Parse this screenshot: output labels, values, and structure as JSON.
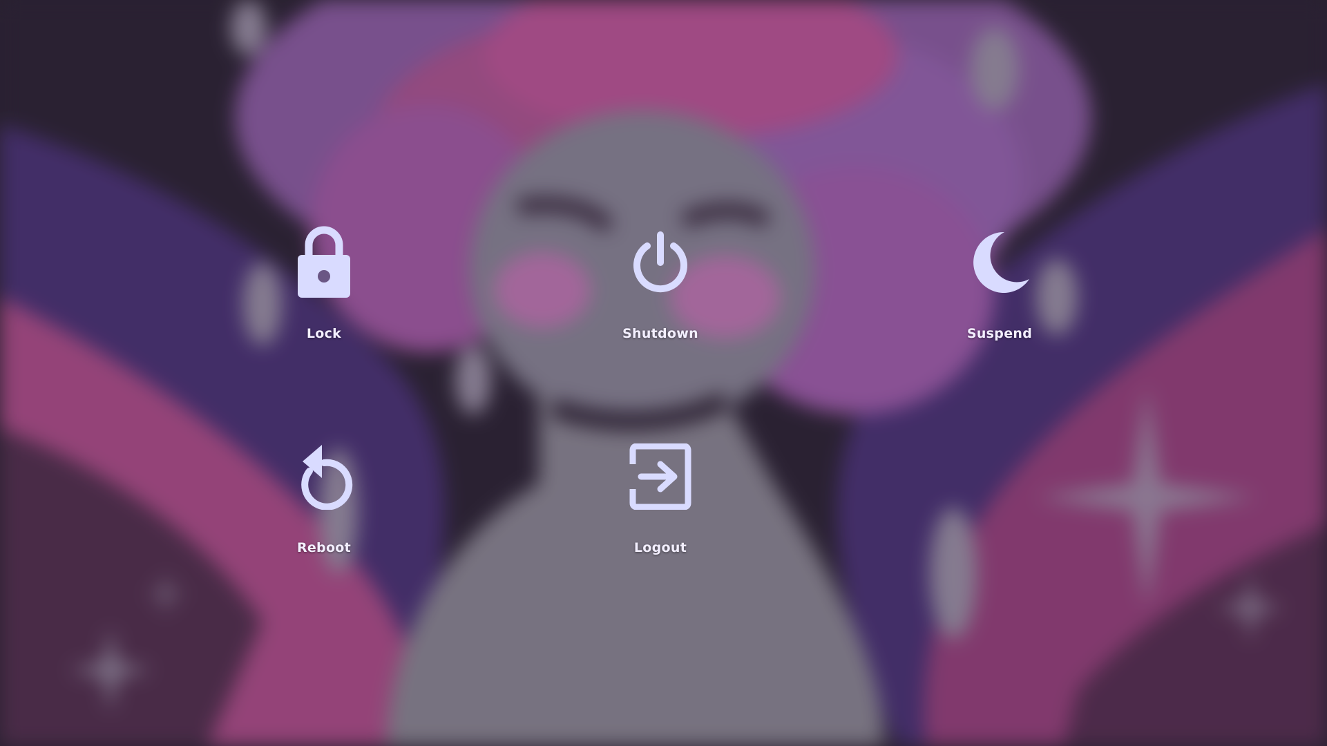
{
  "theme": {
    "icon_color": "#d9dbff",
    "label_color": "#f3efff"
  },
  "actions": [
    {
      "label": "Lock",
      "icon": "lock-icon"
    },
    {
      "label": "Shutdown",
      "icon": "power-icon"
    },
    {
      "label": "Suspend",
      "icon": "moon-icon"
    },
    {
      "label": "Reboot",
      "icon": "reboot-icon"
    },
    {
      "label": "Logout",
      "icon": "logout-icon"
    }
  ]
}
